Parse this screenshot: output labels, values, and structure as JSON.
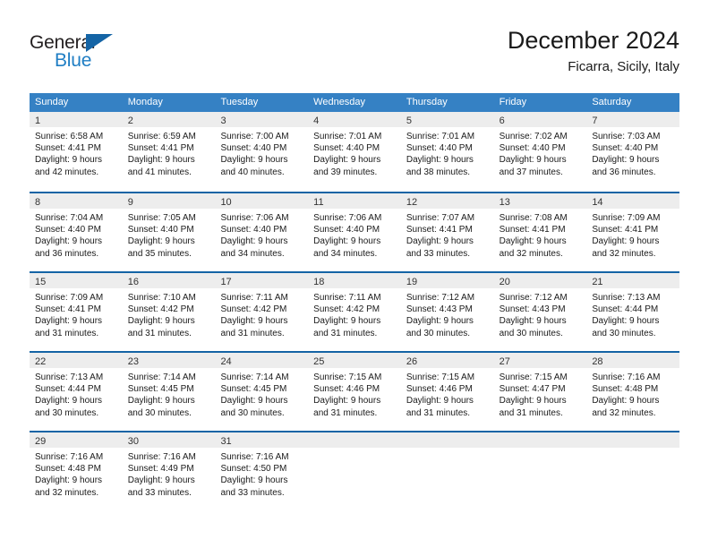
{
  "logo": {
    "primary_text": "General",
    "secondary_text": "Blue",
    "triangle_color": "#1464a5",
    "primary_color": "#231f20",
    "secondary_color": "#1f7ec4"
  },
  "header": {
    "month_title": "December 2024",
    "location": "Ficarra, Sicily, Italy"
  },
  "theme": {
    "header_bg": "#3581c4",
    "row_border": "#1464a5",
    "day_band_bg": "#ededed",
    "text_color": "#1a1a1a"
  },
  "weekdays": [
    "Sunday",
    "Monday",
    "Tuesday",
    "Wednesday",
    "Thursday",
    "Friday",
    "Saturday"
  ],
  "weeks": [
    [
      {
        "day": "1",
        "sunrise": "Sunrise: 6:58 AM",
        "sunset": "Sunset: 4:41 PM",
        "daylight_line1": "Daylight: 9 hours",
        "daylight_line2": "and 42 minutes."
      },
      {
        "day": "2",
        "sunrise": "Sunrise: 6:59 AM",
        "sunset": "Sunset: 4:41 PM",
        "daylight_line1": "Daylight: 9 hours",
        "daylight_line2": "and 41 minutes."
      },
      {
        "day": "3",
        "sunrise": "Sunrise: 7:00 AM",
        "sunset": "Sunset: 4:40 PM",
        "daylight_line1": "Daylight: 9 hours",
        "daylight_line2": "and 40 minutes."
      },
      {
        "day": "4",
        "sunrise": "Sunrise: 7:01 AM",
        "sunset": "Sunset: 4:40 PM",
        "daylight_line1": "Daylight: 9 hours",
        "daylight_line2": "and 39 minutes."
      },
      {
        "day": "5",
        "sunrise": "Sunrise: 7:01 AM",
        "sunset": "Sunset: 4:40 PM",
        "daylight_line1": "Daylight: 9 hours",
        "daylight_line2": "and 38 minutes."
      },
      {
        "day": "6",
        "sunrise": "Sunrise: 7:02 AM",
        "sunset": "Sunset: 4:40 PM",
        "daylight_line1": "Daylight: 9 hours",
        "daylight_line2": "and 37 minutes."
      },
      {
        "day": "7",
        "sunrise": "Sunrise: 7:03 AM",
        "sunset": "Sunset: 4:40 PM",
        "daylight_line1": "Daylight: 9 hours",
        "daylight_line2": "and 36 minutes."
      }
    ],
    [
      {
        "day": "8",
        "sunrise": "Sunrise: 7:04 AM",
        "sunset": "Sunset: 4:40 PM",
        "daylight_line1": "Daylight: 9 hours",
        "daylight_line2": "and 36 minutes."
      },
      {
        "day": "9",
        "sunrise": "Sunrise: 7:05 AM",
        "sunset": "Sunset: 4:40 PM",
        "daylight_line1": "Daylight: 9 hours",
        "daylight_line2": "and 35 minutes."
      },
      {
        "day": "10",
        "sunrise": "Sunrise: 7:06 AM",
        "sunset": "Sunset: 4:40 PM",
        "daylight_line1": "Daylight: 9 hours",
        "daylight_line2": "and 34 minutes."
      },
      {
        "day": "11",
        "sunrise": "Sunrise: 7:06 AM",
        "sunset": "Sunset: 4:40 PM",
        "daylight_line1": "Daylight: 9 hours",
        "daylight_line2": "and 34 minutes."
      },
      {
        "day": "12",
        "sunrise": "Sunrise: 7:07 AM",
        "sunset": "Sunset: 4:41 PM",
        "daylight_line1": "Daylight: 9 hours",
        "daylight_line2": "and 33 minutes."
      },
      {
        "day": "13",
        "sunrise": "Sunrise: 7:08 AM",
        "sunset": "Sunset: 4:41 PM",
        "daylight_line1": "Daylight: 9 hours",
        "daylight_line2": "and 32 minutes."
      },
      {
        "day": "14",
        "sunrise": "Sunrise: 7:09 AM",
        "sunset": "Sunset: 4:41 PM",
        "daylight_line1": "Daylight: 9 hours",
        "daylight_line2": "and 32 minutes."
      }
    ],
    [
      {
        "day": "15",
        "sunrise": "Sunrise: 7:09 AM",
        "sunset": "Sunset: 4:41 PM",
        "daylight_line1": "Daylight: 9 hours",
        "daylight_line2": "and 31 minutes."
      },
      {
        "day": "16",
        "sunrise": "Sunrise: 7:10 AM",
        "sunset": "Sunset: 4:42 PM",
        "daylight_line1": "Daylight: 9 hours",
        "daylight_line2": "and 31 minutes."
      },
      {
        "day": "17",
        "sunrise": "Sunrise: 7:11 AM",
        "sunset": "Sunset: 4:42 PM",
        "daylight_line1": "Daylight: 9 hours",
        "daylight_line2": "and 31 minutes."
      },
      {
        "day": "18",
        "sunrise": "Sunrise: 7:11 AM",
        "sunset": "Sunset: 4:42 PM",
        "daylight_line1": "Daylight: 9 hours",
        "daylight_line2": "and 31 minutes."
      },
      {
        "day": "19",
        "sunrise": "Sunrise: 7:12 AM",
        "sunset": "Sunset: 4:43 PM",
        "daylight_line1": "Daylight: 9 hours",
        "daylight_line2": "and 30 minutes."
      },
      {
        "day": "20",
        "sunrise": "Sunrise: 7:12 AM",
        "sunset": "Sunset: 4:43 PM",
        "daylight_line1": "Daylight: 9 hours",
        "daylight_line2": "and 30 minutes."
      },
      {
        "day": "21",
        "sunrise": "Sunrise: 7:13 AM",
        "sunset": "Sunset: 4:44 PM",
        "daylight_line1": "Daylight: 9 hours",
        "daylight_line2": "and 30 minutes."
      }
    ],
    [
      {
        "day": "22",
        "sunrise": "Sunrise: 7:13 AM",
        "sunset": "Sunset: 4:44 PM",
        "daylight_line1": "Daylight: 9 hours",
        "daylight_line2": "and 30 minutes."
      },
      {
        "day": "23",
        "sunrise": "Sunrise: 7:14 AM",
        "sunset": "Sunset: 4:45 PM",
        "daylight_line1": "Daylight: 9 hours",
        "daylight_line2": "and 30 minutes."
      },
      {
        "day": "24",
        "sunrise": "Sunrise: 7:14 AM",
        "sunset": "Sunset: 4:45 PM",
        "daylight_line1": "Daylight: 9 hours",
        "daylight_line2": "and 30 minutes."
      },
      {
        "day": "25",
        "sunrise": "Sunrise: 7:15 AM",
        "sunset": "Sunset: 4:46 PM",
        "daylight_line1": "Daylight: 9 hours",
        "daylight_line2": "and 31 minutes."
      },
      {
        "day": "26",
        "sunrise": "Sunrise: 7:15 AM",
        "sunset": "Sunset: 4:46 PM",
        "daylight_line1": "Daylight: 9 hours",
        "daylight_line2": "and 31 minutes."
      },
      {
        "day": "27",
        "sunrise": "Sunrise: 7:15 AM",
        "sunset": "Sunset: 4:47 PM",
        "daylight_line1": "Daylight: 9 hours",
        "daylight_line2": "and 31 minutes."
      },
      {
        "day": "28",
        "sunrise": "Sunrise: 7:16 AM",
        "sunset": "Sunset: 4:48 PM",
        "daylight_line1": "Daylight: 9 hours",
        "daylight_line2": "and 32 minutes."
      }
    ],
    [
      {
        "day": "29",
        "sunrise": "Sunrise: 7:16 AM",
        "sunset": "Sunset: 4:48 PM",
        "daylight_line1": "Daylight: 9 hours",
        "daylight_line2": "and 32 minutes."
      },
      {
        "day": "30",
        "sunrise": "Sunrise: 7:16 AM",
        "sunset": "Sunset: 4:49 PM",
        "daylight_line1": "Daylight: 9 hours",
        "daylight_line2": "and 33 minutes."
      },
      {
        "day": "31",
        "sunrise": "Sunrise: 7:16 AM",
        "sunset": "Sunset: 4:50 PM",
        "daylight_line1": "Daylight: 9 hours",
        "daylight_line2": "and 33 minutes."
      },
      {
        "day": "",
        "sunrise": "",
        "sunset": "",
        "daylight_line1": "",
        "daylight_line2": ""
      },
      {
        "day": "",
        "sunrise": "",
        "sunset": "",
        "daylight_line1": "",
        "daylight_line2": ""
      },
      {
        "day": "",
        "sunrise": "",
        "sunset": "",
        "daylight_line1": "",
        "daylight_line2": ""
      },
      {
        "day": "",
        "sunrise": "",
        "sunset": "",
        "daylight_line1": "",
        "daylight_line2": ""
      }
    ]
  ]
}
